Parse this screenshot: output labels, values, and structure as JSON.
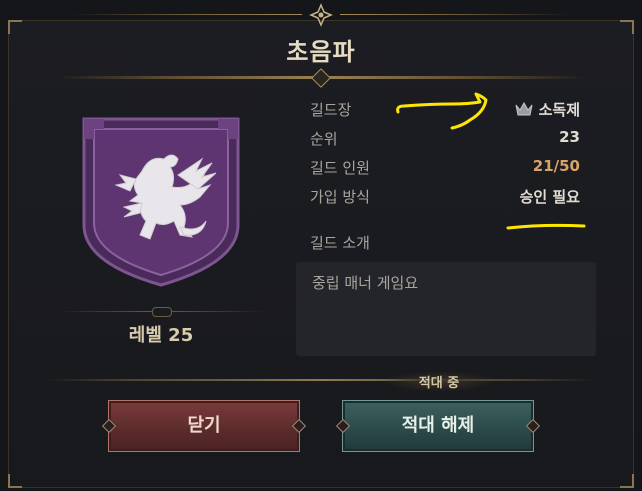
{
  "dialog": {
    "title": "초음파",
    "level": "레벨 25",
    "emblem_icon": "griffin-shield-icon"
  },
  "info": {
    "leader_label": "길드장",
    "leader_value": "소독제",
    "rank_label": "순위",
    "rank_value": "23",
    "members_label": "길드 인원",
    "members_value": "21/50",
    "join_label": "가입 방식",
    "join_value": "승인 필요"
  },
  "intro": {
    "label": "길드 소개",
    "text": "중립 매너 게임요"
  },
  "status": {
    "hostile_label": "적대 중"
  },
  "buttons": {
    "close_label": "닫기",
    "unhostile_label": "적대 해제"
  },
  "colors": {
    "accent_gold": "#b9a57a",
    "members_orange": "#d9a266",
    "annotation_yellow": "#ffe600",
    "emblem_purple": "#5e3570"
  }
}
